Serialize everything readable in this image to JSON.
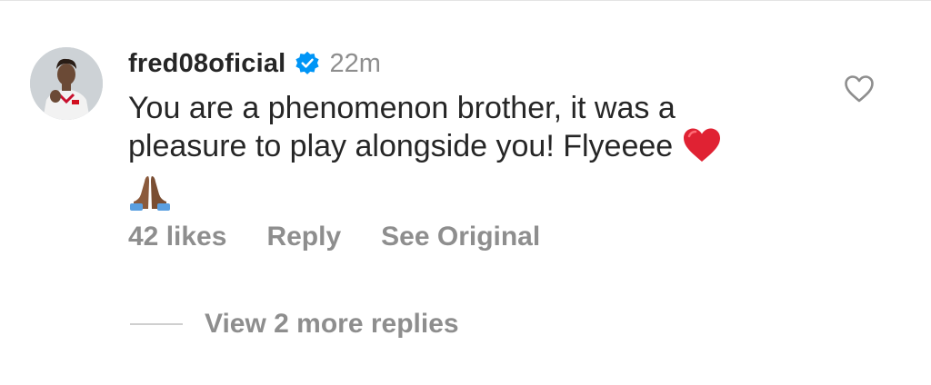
{
  "comment": {
    "username": "fred08oficial",
    "time": "22m",
    "text_main": "You are a phenomenon brother, it was a pleasure to play alongside you! Flyeeee",
    "emoji_1": "red-heart",
    "emoji_2": "folded-hands"
  },
  "actions": {
    "likes": "42 likes",
    "reply": "Reply",
    "see_original": "See Original"
  },
  "replies": {
    "label": "View 2 more replies"
  },
  "icons": {
    "verified": "verified-badge-icon",
    "like": "heart-outline-icon"
  },
  "colors": {
    "verified_blue": "#0095f6",
    "heart_red": "#e02233",
    "secondary_text": "#8e8e8e",
    "primary_text": "#262626"
  }
}
